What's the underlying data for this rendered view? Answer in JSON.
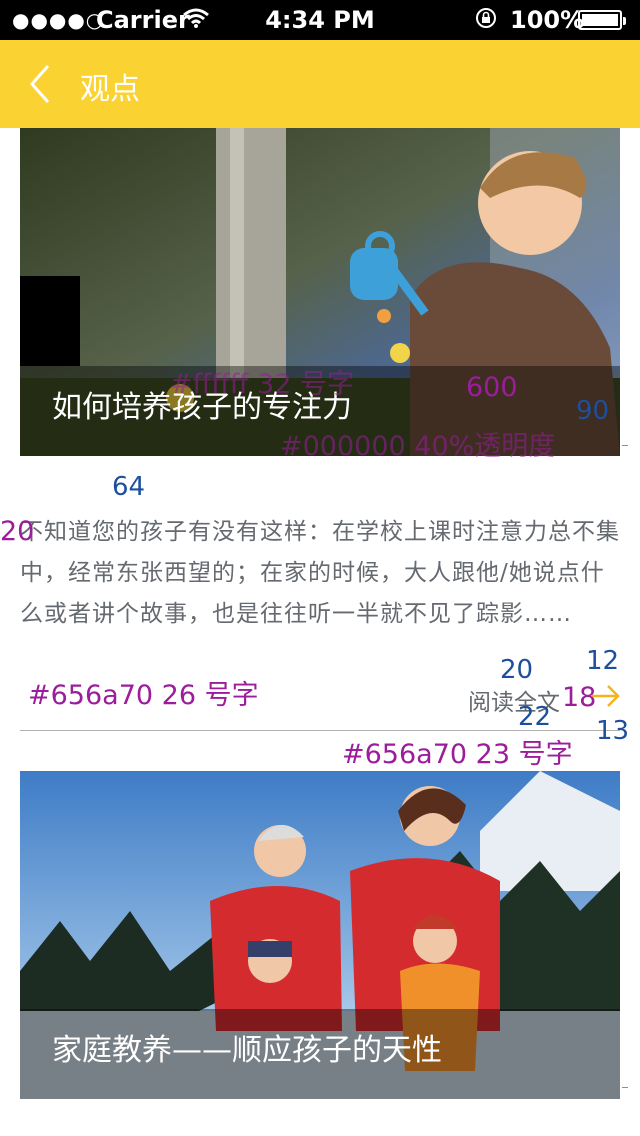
{
  "status_bar": {
    "signal_dots": "●●●●○",
    "carrier": "Carrier",
    "wifi_icon": "wifi-icon",
    "time": "4:34 PM",
    "battery_percent": "100%"
  },
  "nav": {
    "back_icon": "chevron-left-icon",
    "title": "观点"
  },
  "articles": [
    {
      "title": "如何培养孩子的专注力",
      "excerpt": "不知道您的孩子有没有这样：在学校上课时注意力总不集中，经常东张西望的；在家的时候，大人跟他/她说点什么或者讲个故事，也是往往听一半就不见了踪影……",
      "read_more": "阅读全文"
    },
    {
      "title": "家庭教养——顺应孩子的天性"
    }
  ],
  "annotations": {
    "title_spec": "#ffffff  32 号字",
    "overlay_width": "600",
    "overlay_height": "90",
    "overlay_spec": "#000000  40%透明度",
    "gap_top": "64",
    "margin_left": "20",
    "excerpt_spec": "#656a70   26 号字",
    "readmore_gap": "20",
    "arrow_w": "12",
    "arrow_gap": "18",
    "readmore_size": "22",
    "arrow_h": "13",
    "readmore_spec": "#656a70   23 号字"
  },
  "colors": {
    "nav_bg": "#fad232",
    "body_text": "#656a70",
    "accent_arrow": "#f3b51c",
    "annotation_purple": "#9b1d9b",
    "annotation_blue": "#1e4f9c"
  }
}
